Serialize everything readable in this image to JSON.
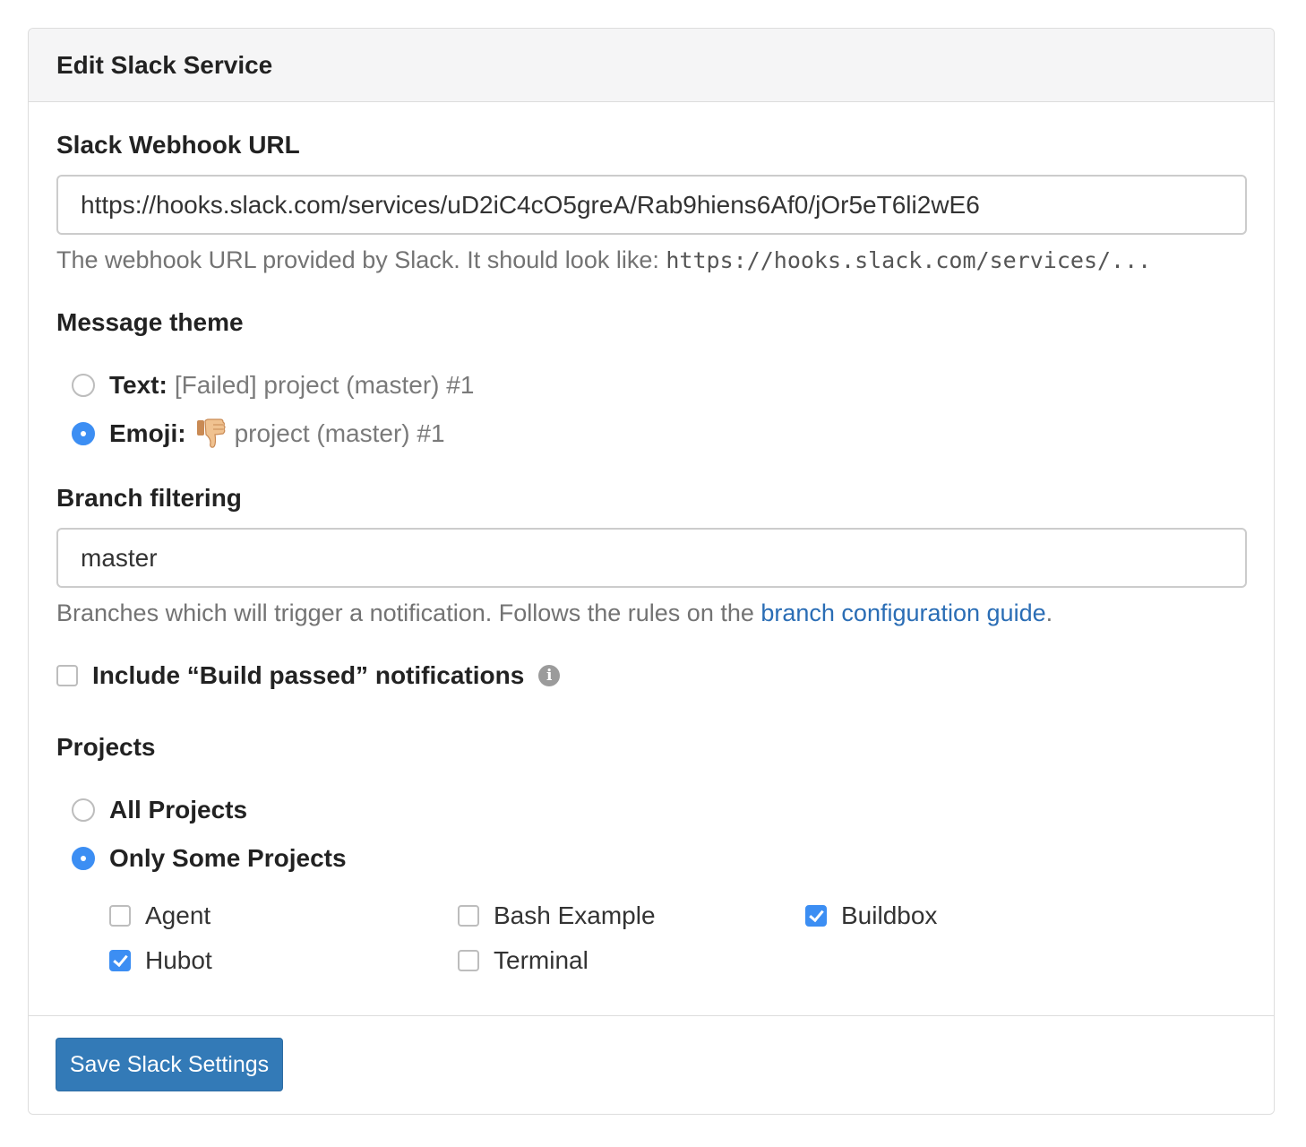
{
  "panel": {
    "title": "Edit Slack Service"
  },
  "webhook": {
    "label": "Slack Webhook URL",
    "value": "https://hooks.slack.com/services/uD2iC4cO5greA/Rab9hiens6Af0/jOr5eT6li2wE6",
    "help_text": "The webhook URL provided by Slack. It should look like: ",
    "help_code": "https://hooks.slack.com/services/..."
  },
  "theme": {
    "label": "Message theme",
    "options": [
      {
        "name": "Text:",
        "description": "[Failed] project (master) #1",
        "selected": false
      },
      {
        "name": "Emoji:",
        "icon": "thumbs-down-icon",
        "description": "project (master) #1",
        "selected": true
      }
    ]
  },
  "branch": {
    "label": "Branch filtering",
    "value": "master",
    "help_text": "Branches which will trigger a notification. Follows the rules on the ",
    "help_link": "branch configuration guide",
    "help_end": "."
  },
  "build_passed": {
    "label": "Include “Build passed” notifications",
    "checked": false,
    "icon": "info-icon"
  },
  "projects": {
    "label": "Projects",
    "scope_options": [
      {
        "label": "All Projects",
        "selected": false
      },
      {
        "label": "Only Some Projects",
        "selected": true
      }
    ],
    "items": [
      {
        "name": "Agent",
        "checked": false
      },
      {
        "name": "Bash Example",
        "checked": false
      },
      {
        "name": "Buildbox",
        "checked": true
      },
      {
        "name": "Hubot",
        "checked": true
      },
      {
        "name": "Terminal",
        "checked": false
      }
    ]
  },
  "footer": {
    "save_label": "Save Slack Settings"
  },
  "colors": {
    "primary_button": "#337ab7",
    "control_checked": "#3c8ef3",
    "link": "#2a6db5"
  }
}
